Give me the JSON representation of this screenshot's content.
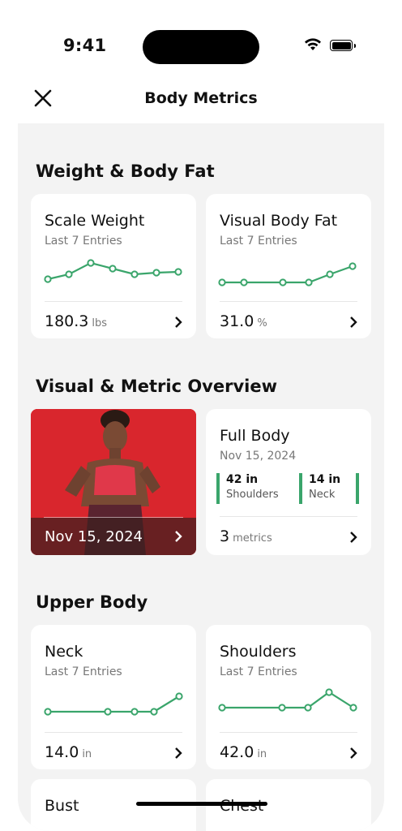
{
  "status": {
    "time": "9:41"
  },
  "nav": {
    "title": "Body Metrics"
  },
  "sections": {
    "weight": "Weight & Body Fat",
    "overview": "Visual & Metric Overview",
    "upper": "Upper Body"
  },
  "cards": {
    "scale_weight": {
      "title": "Scale Weight",
      "subtitle": "Last 7 Entries",
      "value": "180.3",
      "unit": "lbs"
    },
    "visual_body_fat": {
      "title": "Visual Body Fat",
      "subtitle": "Last 7 Entries",
      "value": "31.0",
      "unit": "%"
    },
    "neck": {
      "title": "Neck",
      "subtitle": "Last 7 Entries",
      "value": "14.0",
      "unit": "in"
    },
    "shoulders": {
      "title": "Shoulders",
      "subtitle": "Last 7 Entries",
      "value": "42.0",
      "unit": "in"
    },
    "bust": {
      "title": "Bust"
    },
    "chest": {
      "title": "Chest"
    }
  },
  "overview": {
    "photo_date": "Nov 15, 2024",
    "title": "Full Body",
    "date": "Nov 15, 2024",
    "measurements": [
      {
        "value": "42 in",
        "label": "Shoulders"
      },
      {
        "value": "14 in",
        "label": "Neck"
      }
    ],
    "metrics_count": "3",
    "metrics_label": "metrics"
  },
  "colors": {
    "accent": "#3aa56b",
    "photo_bg": "#d9262d"
  },
  "icons": {
    "close": "close-icon",
    "chevron": "chevron-right-icon",
    "wifi": "wifi-icon",
    "battery": "battery-icon"
  }
}
